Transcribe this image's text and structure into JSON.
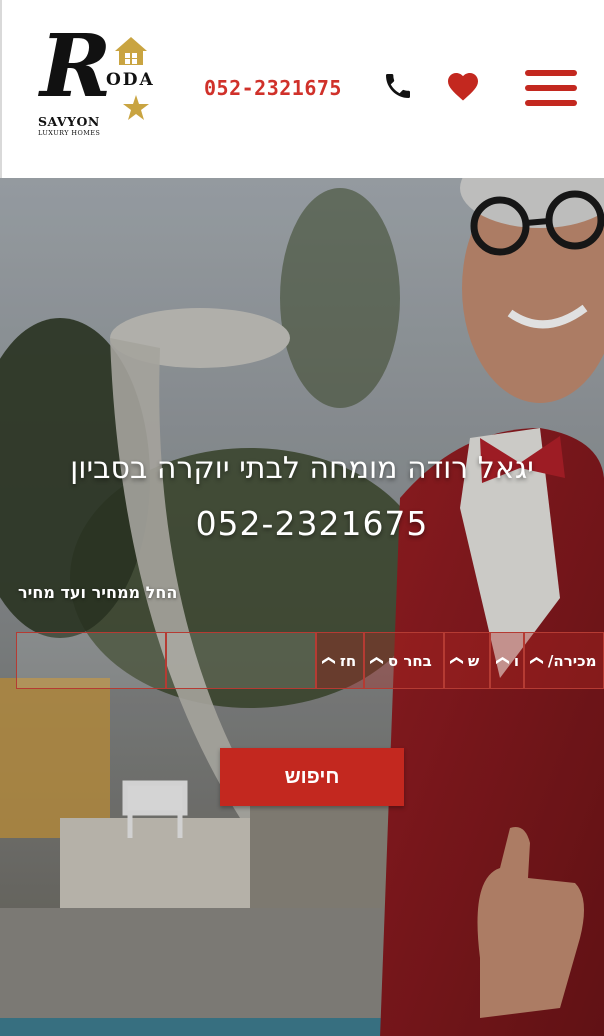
{
  "header": {
    "logo": {
      "letter": "R",
      "oda": "ODA",
      "savyon": "SAVYON",
      "luxury": "LUXURY HOMES"
    },
    "phone_number": "052-2321675",
    "icons": {
      "phone": "phone-icon",
      "favorites": "heart-icon",
      "menu": "hamburger-menu-icon"
    }
  },
  "hero": {
    "headline": "יגאל רודה מומחה לבתי יוקרה בסביון",
    "phone": "052-2321675",
    "price_label": "החל ממחיר ועד מחיר",
    "filters": {
      "sale_type": "מכירה/",
      "select_2": "ו",
      "select_3": "ש",
      "select_4": "בחר ס",
      "select_5": "חז"
    },
    "search_label": "חיפוש"
  },
  "colors": {
    "accent": "#c3281f",
    "phone_text": "#d0312a",
    "header_bg": "#ffffff"
  }
}
